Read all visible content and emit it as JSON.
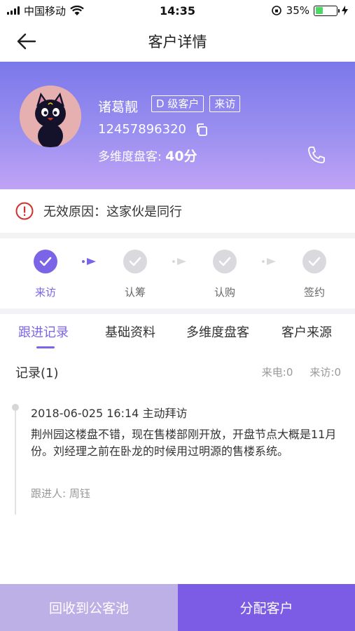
{
  "status_bar": {
    "carrier": "中国移动",
    "time": "14:35",
    "battery_percent": "35%",
    "battery_level": 0.35
  },
  "nav": {
    "title": "客户详情",
    "back_icon": "back-arrow-icon"
  },
  "customer": {
    "name": "诸葛靓",
    "tags": [
      "D 级客户",
      "来访"
    ],
    "phone": "12457896320",
    "score_label": "多维度盘客:",
    "score_value": "40分"
  },
  "invalid": {
    "text": "无效原因：这家伙是同行"
  },
  "steps": [
    {
      "label": "来访",
      "active": true
    },
    {
      "label": "认筹",
      "active": false
    },
    {
      "label": "认购",
      "active": false
    },
    {
      "label": "签约",
      "active": false
    }
  ],
  "tabs": [
    {
      "label": "跟进记录",
      "active": true
    },
    {
      "label": "基础资料",
      "active": false
    },
    {
      "label": "多维度盘客",
      "active": false
    },
    {
      "label": "客户来源",
      "active": false
    }
  ],
  "records": {
    "title": "记录(1)",
    "calls": "来电:0",
    "visits": "来访:0",
    "items": [
      {
        "time": "2018-06-025 16:14 主动拜访",
        "body": "荆州园这楼盘不错，现在售楼部刚开放，开盘节点大概是11月份。刘经理之前在卧龙的时候用过明源的售楼系统。",
        "owner": "跟进人:  周钰"
      }
    ]
  },
  "actions": {
    "recycle": "回收到公客池",
    "assign": "分配客户"
  },
  "colors": {
    "accent": "#7c64e6",
    "header_gradient_top": "#7b78ea",
    "header_gradient_bottom": "#c0a3f5",
    "warning": "#d0312d"
  }
}
